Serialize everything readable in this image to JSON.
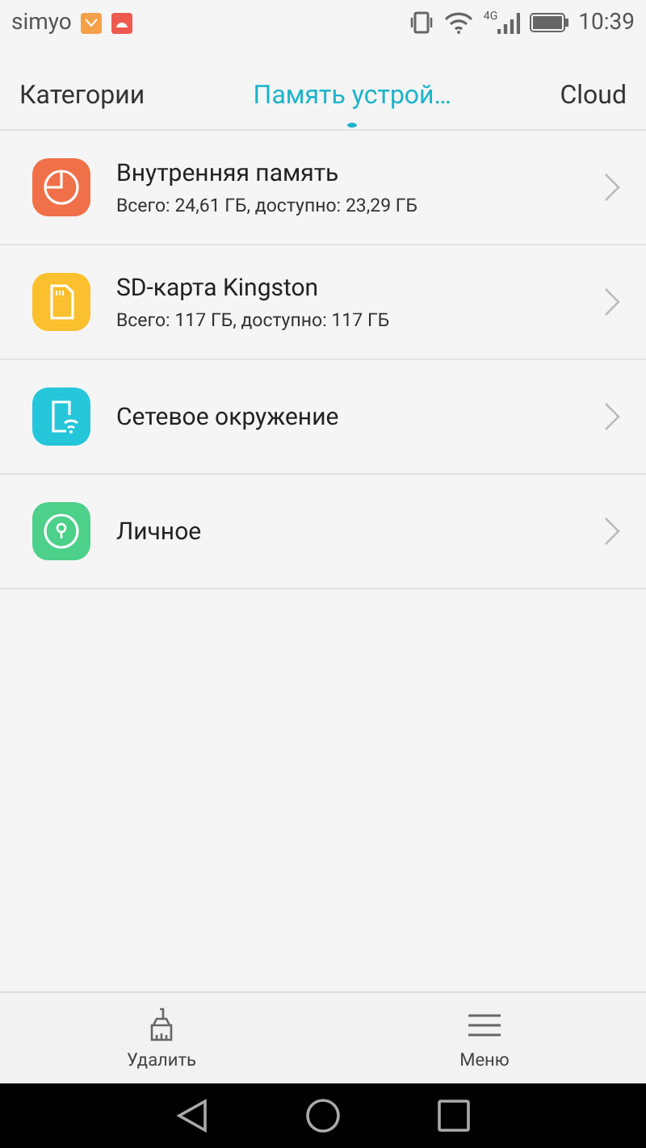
{
  "status_bar": {
    "carrier": "simyo",
    "time": "10:39",
    "network": "4G"
  },
  "tabs": [
    {
      "label": "Категории",
      "selected": false
    },
    {
      "label": "Память устрой…",
      "selected": true
    },
    {
      "label": "Cloud",
      "selected": false
    }
  ],
  "locations": [
    {
      "kind": "storage",
      "color": "#f0704a",
      "title": "Внутренняя память",
      "subtitle": "Всего: 24,61 ГБ, доступно: 23,29 ГБ"
    },
    {
      "kind": "sdcard",
      "color": "#fbc02d",
      "title": "SD-карта Kingston",
      "subtitle": "Всего: 117 ГБ, доступно: 117 ГБ"
    },
    {
      "kind": "network",
      "color": "#26c6da",
      "title": "Сетевое окружение"
    },
    {
      "kind": "private",
      "color": "#4cd08a",
      "title": "Личное"
    }
  ],
  "bottom_bar": [
    {
      "kind": "clean",
      "label": "Удалить"
    },
    {
      "kind": "menu",
      "label": "Меню"
    }
  ]
}
